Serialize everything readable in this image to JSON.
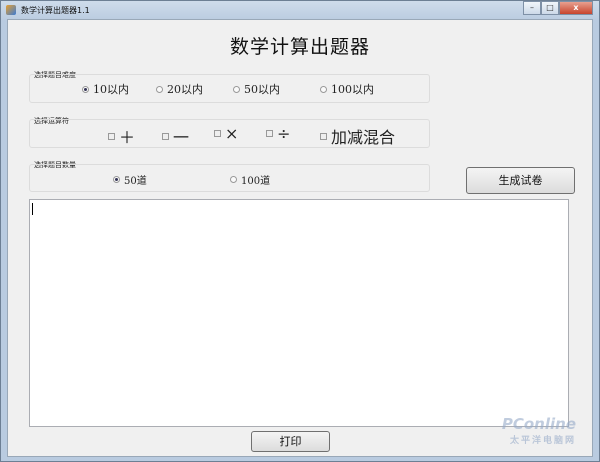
{
  "window": {
    "title": "数学计算出题器1.1",
    "minimize": "–",
    "maximize": "□",
    "close": "x"
  },
  "heading": "数学计算出题器",
  "difficulty": {
    "label": "选择题目难度",
    "options": [
      {
        "label": "10以内",
        "selected": true
      },
      {
        "label": "20以内",
        "selected": false
      },
      {
        "label": "50以内",
        "selected": false
      },
      {
        "label": "100以内",
        "selected": false
      }
    ]
  },
  "operators": {
    "label": "选择运算符",
    "options": [
      {
        "label": "＋",
        "checked": false
      },
      {
        "label": "一",
        "checked": false
      },
      {
        "label": "×",
        "checked": false
      },
      {
        "label": "÷",
        "checked": false
      },
      {
        "label": "加减混合",
        "checked": false
      }
    ]
  },
  "count": {
    "label": "选择题目数量",
    "options": [
      {
        "label": "50道",
        "selected": true
      },
      {
        "label": "100道",
        "selected": false
      }
    ]
  },
  "generate_button": "生成试卷",
  "output_text": "",
  "print_button": "打印",
  "watermark": {
    "logo": "PConline",
    "sub": "太平洋电脑网"
  }
}
